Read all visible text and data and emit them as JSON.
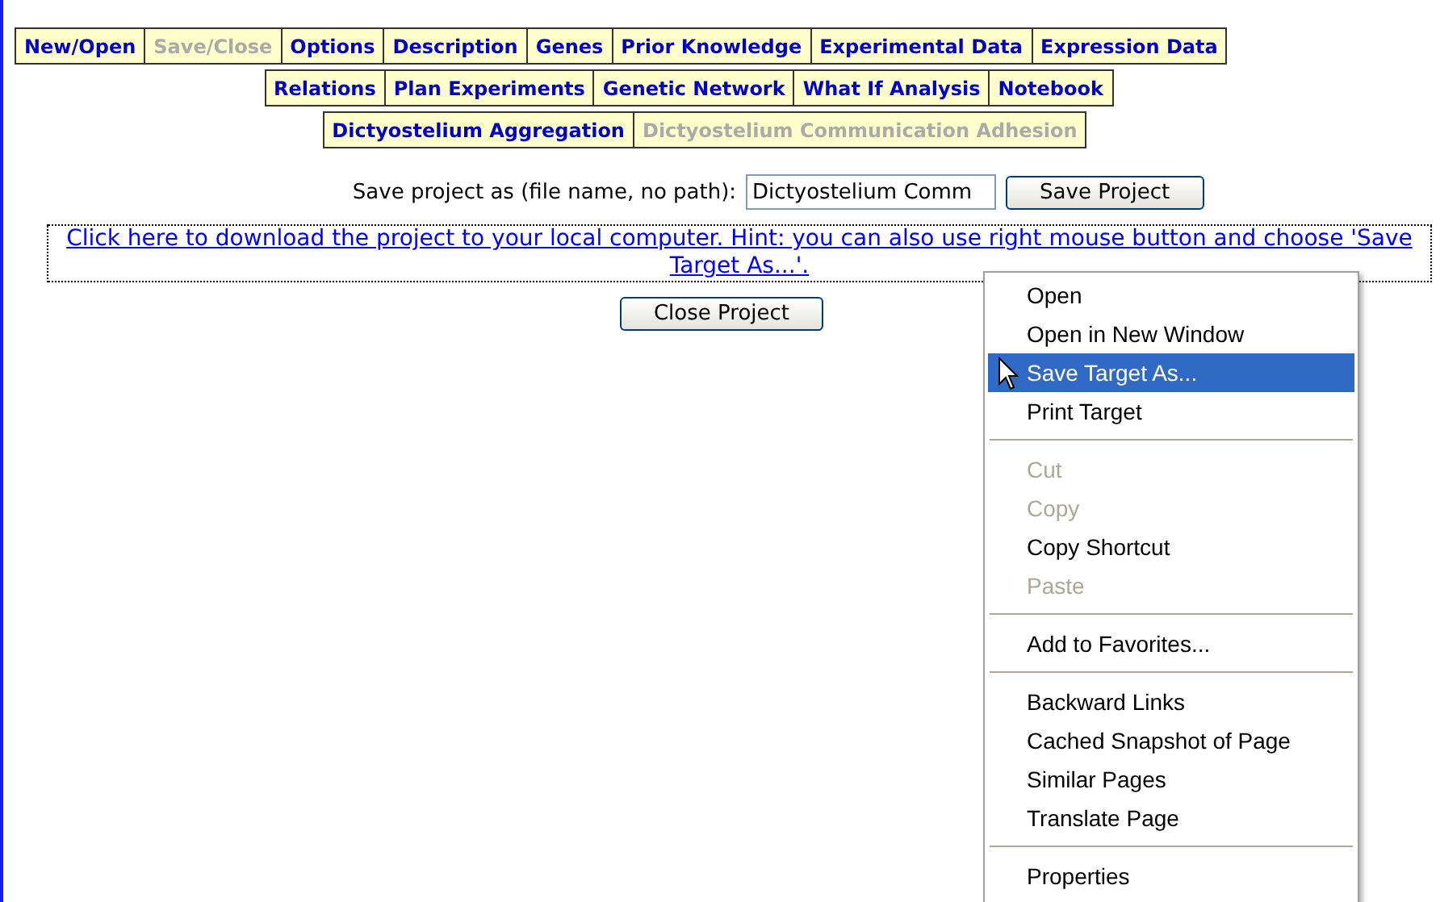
{
  "tab_rows": [
    [
      {
        "label": "New/Open",
        "disabled": false
      },
      {
        "label": "Save/Close",
        "disabled": true
      },
      {
        "label": "Options",
        "disabled": false
      },
      {
        "label": "Description",
        "disabled": false
      },
      {
        "label": "Genes",
        "disabled": false
      },
      {
        "label": "Prior Knowledge",
        "disabled": false
      },
      {
        "label": "Experimental Data",
        "disabled": false
      },
      {
        "label": "Expression Data",
        "disabled": false
      }
    ],
    [
      {
        "label": "Relations",
        "disabled": false
      },
      {
        "label": "Plan Experiments",
        "disabled": false
      },
      {
        "label": "Genetic Network",
        "disabled": false
      },
      {
        "label": "What If Analysis",
        "disabled": false
      },
      {
        "label": "Notebook",
        "disabled": false
      }
    ],
    [
      {
        "label": "Dictyostelium Aggregation",
        "disabled": false
      },
      {
        "label": "Dictyostelium Communication Adhesion",
        "disabled": true
      }
    ]
  ],
  "save_form": {
    "label": "Save project as (file name, no path):",
    "value": "Dictyostelium Comm",
    "button": "Save Project"
  },
  "download_link": "Click here to download the project to your local computer. Hint: you can also use right mouse button and choose 'Save Target As...'.",
  "close_button": "Close Project",
  "context_menu": [
    {
      "kind": "item",
      "label": "Open",
      "disabled": false,
      "selected": false
    },
    {
      "kind": "item",
      "label": "Open in New Window",
      "disabled": false,
      "selected": false
    },
    {
      "kind": "item",
      "label": "Save Target As...",
      "disabled": false,
      "selected": true
    },
    {
      "kind": "item",
      "label": "Print Target",
      "disabled": false,
      "selected": false
    },
    {
      "kind": "separator"
    },
    {
      "kind": "item",
      "label": "Cut",
      "disabled": true,
      "selected": false
    },
    {
      "kind": "item",
      "label": "Copy",
      "disabled": true,
      "selected": false
    },
    {
      "kind": "item",
      "label": "Copy Shortcut",
      "disabled": false,
      "selected": false
    },
    {
      "kind": "item",
      "label": "Paste",
      "disabled": true,
      "selected": false
    },
    {
      "kind": "separator"
    },
    {
      "kind": "item",
      "label": "Add to Favorites...",
      "disabled": false,
      "selected": false
    },
    {
      "kind": "separator"
    },
    {
      "kind": "item",
      "label": "Backward Links",
      "disabled": false,
      "selected": false
    },
    {
      "kind": "item",
      "label": "Cached Snapshot of Page",
      "disabled": false,
      "selected": false
    },
    {
      "kind": "item",
      "label": "Similar Pages",
      "disabled": false,
      "selected": false
    },
    {
      "kind": "item",
      "label": "Translate Page",
      "disabled": false,
      "selected": false
    },
    {
      "kind": "separator"
    },
    {
      "kind": "item",
      "label": "Properties",
      "disabled": false,
      "selected": false
    }
  ]
}
